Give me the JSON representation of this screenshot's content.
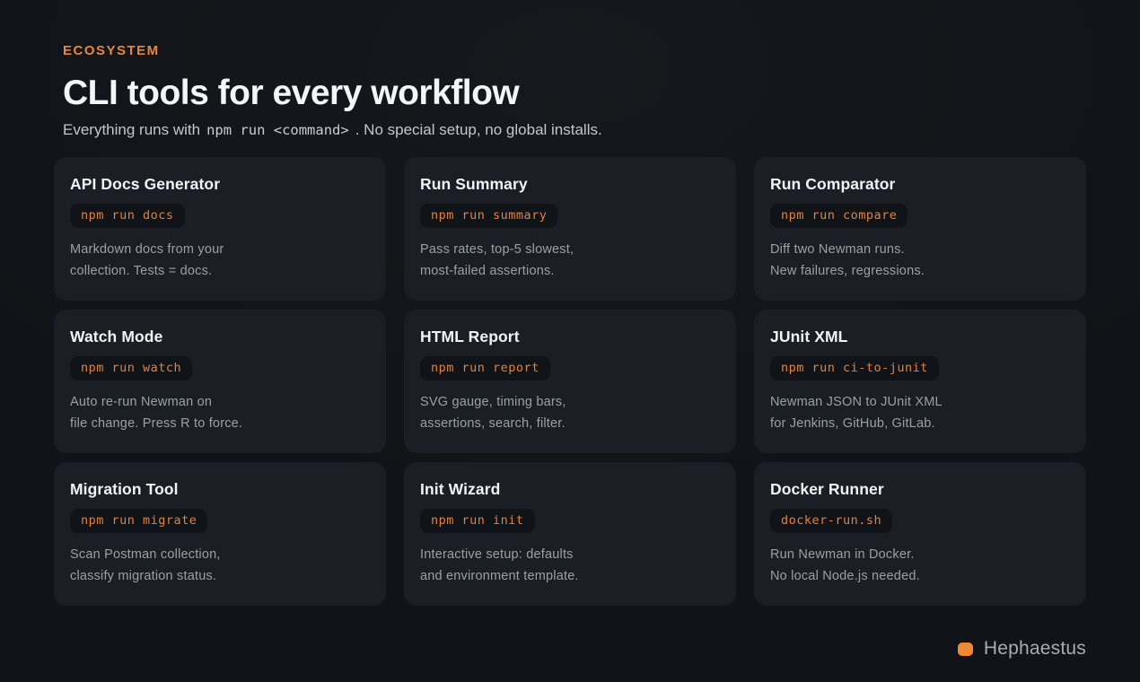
{
  "colors": {
    "accent_orange": "#e8873a",
    "code_orange": "#e5813a",
    "brand_orange": "#ee8a35",
    "background": "#121318",
    "card_background": "#1b1e25",
    "badge_background": "#101318",
    "heading_text": "#f4f5f7",
    "body_text": "#9aa0a8"
  },
  "header": {
    "eyebrow": "ECOSYSTEM",
    "title": "CLI tools for every workflow",
    "subtitle_prefix": "Everything runs with",
    "subtitle_code": "npm run <command>",
    "subtitle_suffix": ". No special setup, no global installs."
  },
  "cards": [
    {
      "title": "API Docs Generator",
      "command": "npm run docs",
      "desc_line1": "Markdown docs from your",
      "desc_line2": "collection. Tests = docs."
    },
    {
      "title": "Run Summary",
      "command": "npm run summary",
      "desc_line1": "Pass rates, top-5 slowest,",
      "desc_line2": "most-failed assertions."
    },
    {
      "title": "Run Comparator",
      "command": "npm run compare",
      "desc_line1": "Diff two Newman runs.",
      "desc_line2": "New failures, regressions."
    },
    {
      "title": "Watch Mode",
      "command": "npm run watch",
      "desc_line1": "Auto re-run Newman on",
      "desc_line2": "file change. Press R to force."
    },
    {
      "title": "HTML Report",
      "command": "npm run report",
      "desc_line1": "SVG gauge, timing bars,",
      "desc_line2": "assertions, search, filter."
    },
    {
      "title": "JUnit XML",
      "command": "npm run ci-to-junit",
      "desc_line1": "Newman JSON to JUnit XML",
      "desc_line2": "for Jenkins, GitHub, GitLab."
    },
    {
      "title": "Migration Tool",
      "command": "npm run migrate",
      "desc_line1": "Scan Postman collection,",
      "desc_line2": "classify migration status."
    },
    {
      "title": "Init Wizard",
      "command": "npm run init",
      "desc_line1": "Interactive setup: defaults",
      "desc_line2": "and environment template."
    },
    {
      "title": "Docker Runner",
      "command": "docker-run.sh",
      "desc_line1": "Run Newman in Docker.",
      "desc_line2": "No local Node.js needed."
    }
  ],
  "footer": {
    "brand": "Hephaestus"
  }
}
